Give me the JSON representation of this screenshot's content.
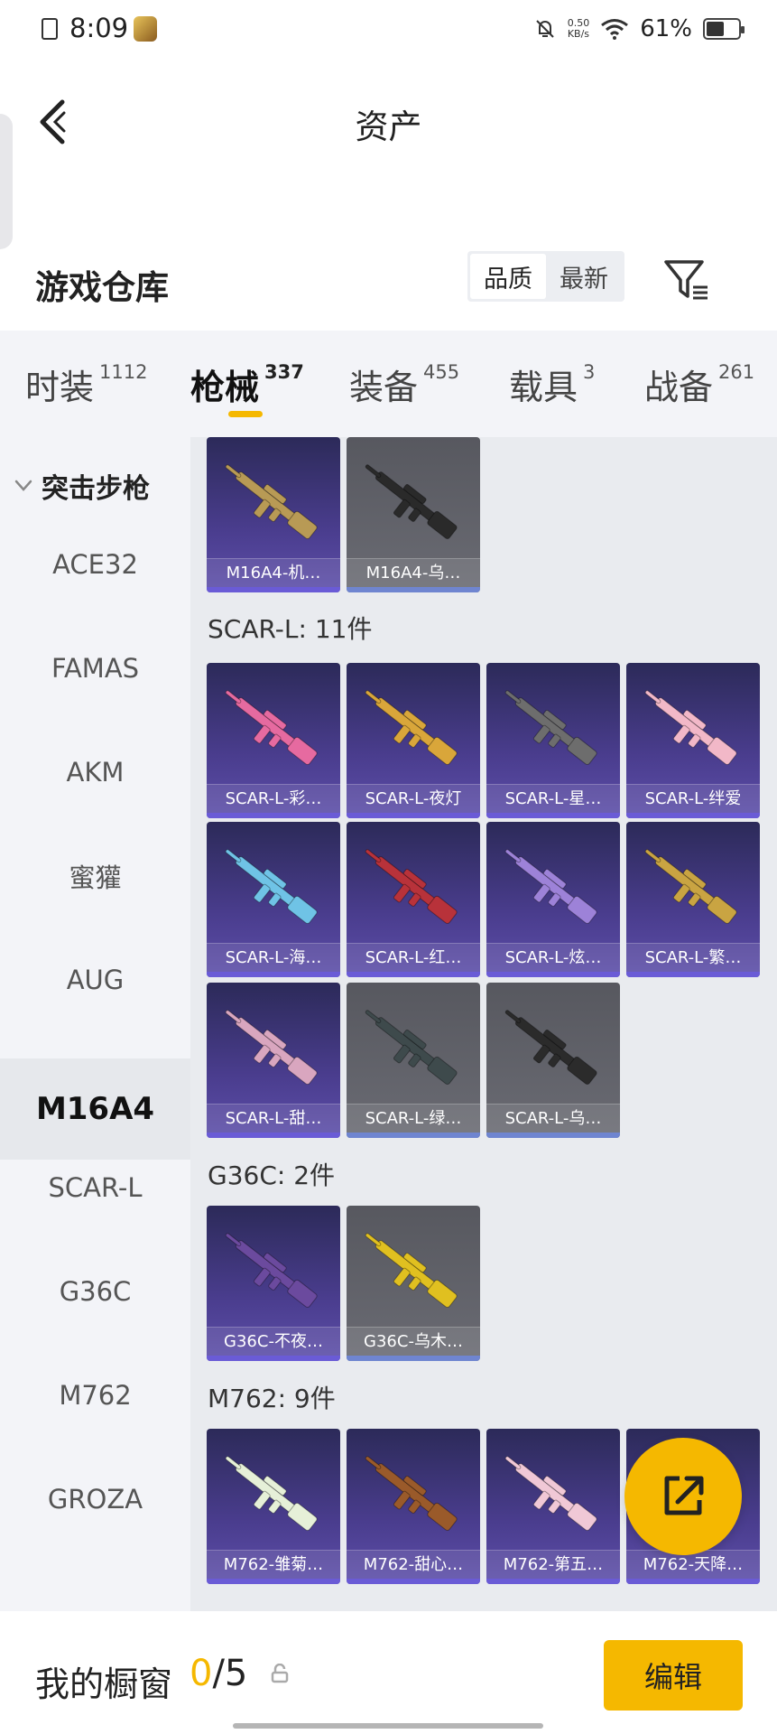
{
  "status_bar": {
    "time": "8:09",
    "speed_value": "0.50",
    "speed_unit": "KB/s",
    "battery": "61%",
    "battery_level": 0.61
  },
  "header": {
    "title": "资产"
  },
  "warehouse": {
    "title": "游戏仓库",
    "sort_options": [
      {
        "label": "品质",
        "active": true
      },
      {
        "label": "最新",
        "active": false
      }
    ]
  },
  "tabs": [
    {
      "label": "时装",
      "count": "1112",
      "active": false
    },
    {
      "label": "枪械",
      "count": "337",
      "active": true
    },
    {
      "label": "装备",
      "count": "455",
      "active": false
    },
    {
      "label": "载具",
      "count": "3",
      "active": false
    },
    {
      "label": "战备",
      "count": "261",
      "active": false
    }
  ],
  "sidebar": {
    "group": "突击步枪",
    "items": [
      {
        "label": "ACE32",
        "active": false
      },
      {
        "label": "FAMAS",
        "active": false
      },
      {
        "label": "AKM",
        "active": false
      },
      {
        "label": "蜜獾",
        "active": false
      },
      {
        "label": "AUG",
        "active": false
      },
      {
        "label": "M16A4",
        "active": true
      },
      {
        "label": "SCAR-L",
        "active": false
      },
      {
        "label": "G36C",
        "active": false
      },
      {
        "label": "M762",
        "active": false
      },
      {
        "label": "GROZA",
        "active": false
      }
    ]
  },
  "sections": [
    {
      "title": "",
      "items": [
        {
          "name": "M16A4-机…",
          "rarity": "purple",
          "color": "#b89a55"
        },
        {
          "name": "M16A4-乌…",
          "rarity": "grey",
          "color": "#2a2a2a"
        }
      ]
    },
    {
      "title": "SCAR-L: 11件",
      "items": [
        {
          "name": "SCAR-L-彩…",
          "rarity": "purple",
          "color": "#e66aa0"
        },
        {
          "name": "SCAR-L-夜灯",
          "rarity": "purple",
          "color": "#d9a63a"
        },
        {
          "name": "SCAR-L-星…",
          "rarity": "purple",
          "color": "#6d6d6d"
        },
        {
          "name": "SCAR-L-绊爱",
          "rarity": "purple",
          "color": "#f2b8c8"
        },
        {
          "name": "SCAR-L-海…",
          "rarity": "purple",
          "color": "#6fc3e6"
        },
        {
          "name": "SCAR-L-红…",
          "rarity": "purple",
          "color": "#b8323a"
        },
        {
          "name": "SCAR-L-炫…",
          "rarity": "purple",
          "color": "#9d82d8"
        },
        {
          "name": "SCAR-L-繁…",
          "rarity": "purple",
          "color": "#c9a442"
        },
        {
          "name": "SCAR-L-甜…",
          "rarity": "purple",
          "color": "#d9a6bf"
        },
        {
          "name": "SCAR-L-绿…",
          "rarity": "grey",
          "color": "#3e4a4c"
        },
        {
          "name": "SCAR-L-乌…",
          "rarity": "grey",
          "color": "#2b2b2b"
        }
      ]
    },
    {
      "title": "G36C: 2件",
      "items": [
        {
          "name": "G36C-不夜…",
          "rarity": "purple",
          "color": "#6b4a9e"
        },
        {
          "name": "G36C-乌木…",
          "rarity": "grey",
          "color": "#e0c020"
        }
      ]
    },
    {
      "title": "M762: 9件",
      "items": [
        {
          "name": "M762-雏菊…",
          "rarity": "purple",
          "color": "#e6f0d8"
        },
        {
          "name": "M762-甜心…",
          "rarity": "purple",
          "color": "#9a5a2a"
        },
        {
          "name": "M762-第五…",
          "rarity": "purple",
          "color": "#f0c8d6"
        },
        {
          "name": "M762-天降…",
          "rarity": "purple",
          "color": "#8a8aa0"
        }
      ]
    }
  ],
  "bottom": {
    "label": "我的橱窗",
    "current": "0",
    "total": "/5",
    "edit_label": "编辑"
  },
  "colors": {
    "accent": "#f5b800",
    "purple_card": "#4a3d8e",
    "grey_card": "#62636b",
    "sidebar_bg": "#f3f4f8"
  },
  "icons": {
    "back": "chevron-left-icon",
    "filter": "filter-icon",
    "share": "share-out-icon",
    "lock": "lock-icon"
  }
}
